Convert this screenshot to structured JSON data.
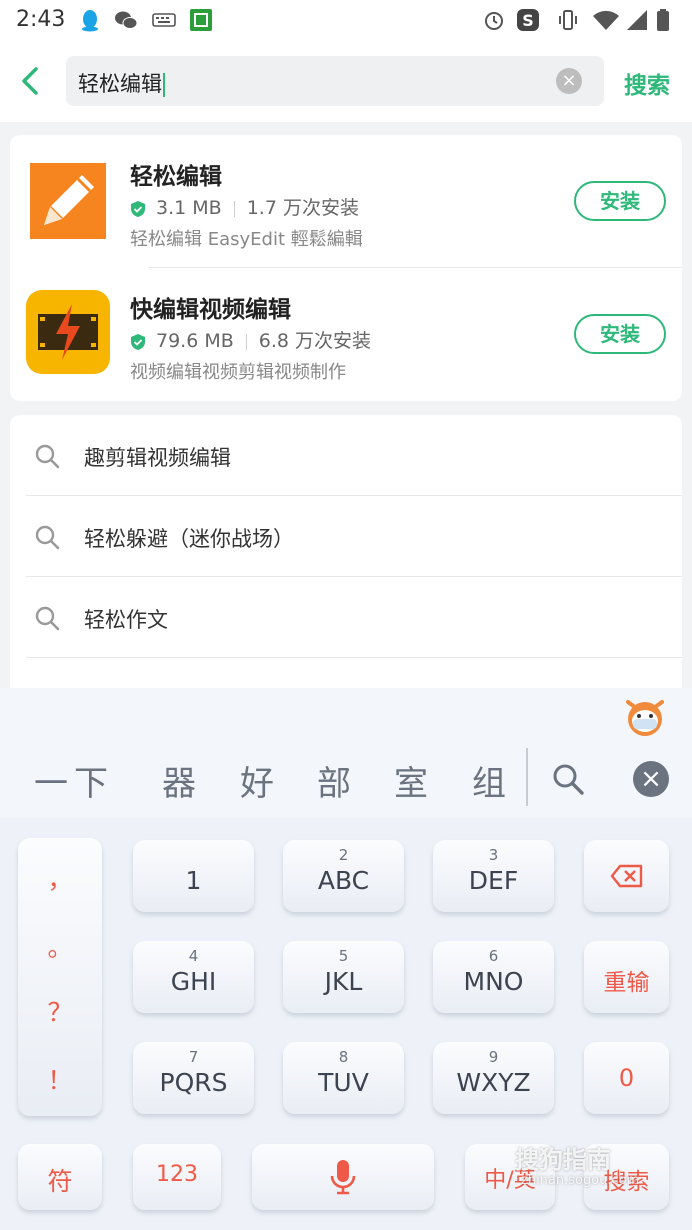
{
  "status_bar": {
    "time": "2:43"
  },
  "search": {
    "value": "轻松编辑",
    "button_label": "搜索"
  },
  "apps": [
    {
      "name": "轻松编辑",
      "size": "3.1 MB",
      "installs": "1.7 万次安装",
      "desc": "轻松编辑 EasyEdit 輕鬆編輯",
      "install_label": "安装"
    },
    {
      "name": "快编辑视频编辑",
      "size": "79.6 MB",
      "installs": "6.8 万次安装",
      "desc": "视频编辑视频剪辑视频制作",
      "install_label": "安装"
    }
  ],
  "suggestions": [
    "趣剪辑视频编辑",
    "轻松躲避（迷你战场）",
    "轻松作文"
  ],
  "keyboard": {
    "candidates": [
      "一下",
      "器",
      "好",
      "部",
      "室",
      "组"
    ],
    "punct": [
      "，",
      "。",
      "？",
      "！"
    ],
    "keys": [
      {
        "num": "",
        "label": "1"
      },
      {
        "num": "2",
        "label": "ABC"
      },
      {
        "num": "3",
        "label": "DEF"
      },
      {
        "num": "4",
        "label": "GHI"
      },
      {
        "num": "5",
        "label": "JKL"
      },
      {
        "num": "6",
        "label": "MNO"
      },
      {
        "num": "7",
        "label": "PQRS"
      },
      {
        "num": "8",
        "label": "TUV"
      },
      {
        "num": "9",
        "label": "WXYZ"
      }
    ],
    "reinput": "重输",
    "zero": "0",
    "symbol": "符",
    "num_mode": "123",
    "lang": "中/英",
    "search": "搜索"
  },
  "watermark": {
    "text": "搜狗指南",
    "sub": "zhinan.sogou.com"
  },
  "colors": {
    "accent": "#2eb87a",
    "key_red": "#ef5a48"
  }
}
